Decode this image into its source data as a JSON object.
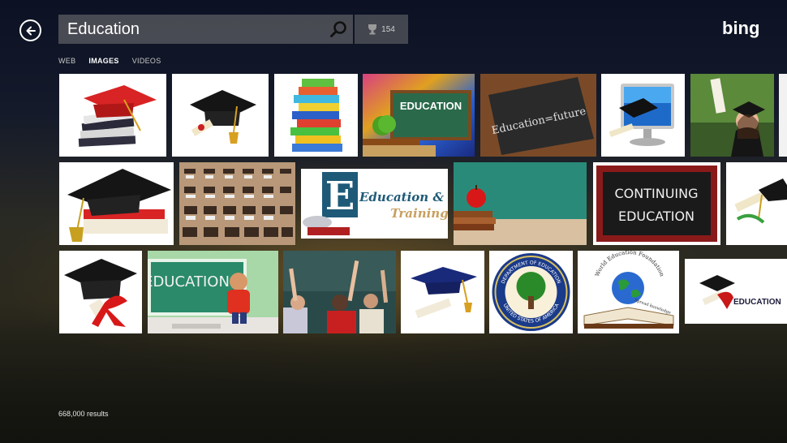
{
  "search": {
    "query": "Education",
    "rewards_count": "154"
  },
  "brand": {
    "logo_text": "bing"
  },
  "tabs": [
    {
      "label": "WEB",
      "active": false
    },
    {
      "label": "IMAGES",
      "active": true
    },
    {
      "label": "VIDEOS",
      "active": false
    }
  ],
  "tile_text": {
    "chalkboard_education": "EDUCATION",
    "education_future": "Education=future",
    "education_training_1": "Education &",
    "education_training_2": "Training",
    "continuing_1": "CONTINUING",
    "continuing_2": "EDUCATION",
    "classroom_board": "EDUCATION",
    "dept_seal_top": "DEPARTMENT OF EDUCATION",
    "dept_seal_bottom": "UNITED STATES OF AMERICA",
    "world_foundation": "World Education Foundation",
    "spread_knowledge": "Spread knowledge",
    "cap_education": "EDUCATION"
  },
  "footer": {
    "results": "668,000 results"
  },
  "colors": {
    "accent": "#ffffff",
    "search_bg": "#787878"
  }
}
